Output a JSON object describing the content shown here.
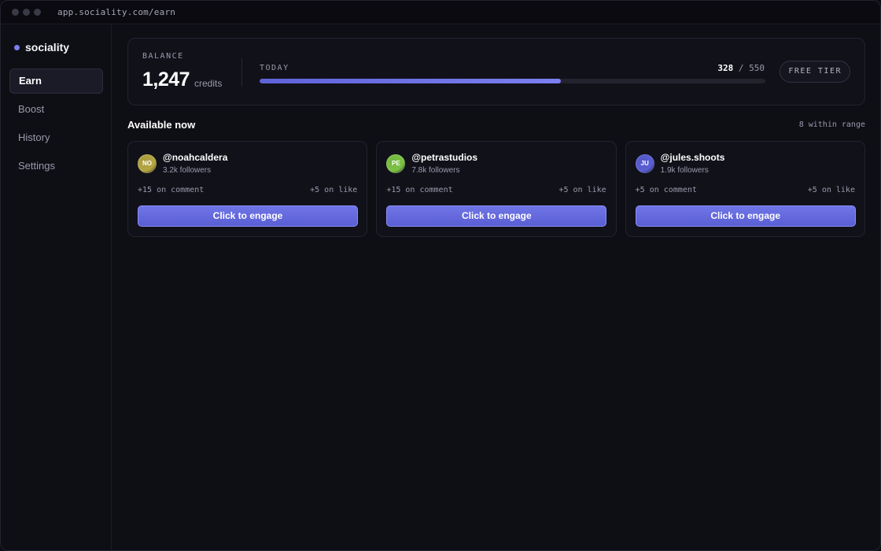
{
  "browser": {
    "url": "app.sociality.com/earn"
  },
  "sidebar": {
    "brand": "sociality",
    "items": [
      {
        "label": "Earn",
        "active": true
      },
      {
        "label": "Boost",
        "active": false
      },
      {
        "label": "History",
        "active": false
      },
      {
        "label": "Settings",
        "active": false
      }
    ]
  },
  "balance": {
    "label": "BALANCE",
    "value": "1,247",
    "unit": "credits"
  },
  "today": {
    "label": "TODAY",
    "current": "328",
    "separator": "/",
    "limit": "550",
    "progress_fraction": 0.596
  },
  "tier": {
    "label": "FREE TIER"
  },
  "available": {
    "title": "Available now",
    "meta": "8 within range"
  },
  "cards": [
    {
      "initials": "NO",
      "handle": "@noahcaldera",
      "followers": "3.2k followers",
      "comment_reward": "+15 on comment",
      "like_reward": "+5 on like",
      "button": "Click to engage",
      "avatar_color": "#b5a642"
    },
    {
      "initials": "PE",
      "handle": "@petrastudios",
      "followers": "7.8k followers",
      "comment_reward": "+15 on comment",
      "like_reward": "+5 on like",
      "button": "Click to engage",
      "avatar_color": "#7cc244"
    },
    {
      "initials": "JU",
      "handle": "@jules.shoots",
      "followers": "1.9k followers",
      "comment_reward": "+5 on comment",
      "like_reward": "+5 on like",
      "button": "Click to engage",
      "avatar_color": "#5a5ed4"
    }
  ],
  "colors": {
    "accent": "#7b7ff0",
    "background": "#0e0e15"
  }
}
